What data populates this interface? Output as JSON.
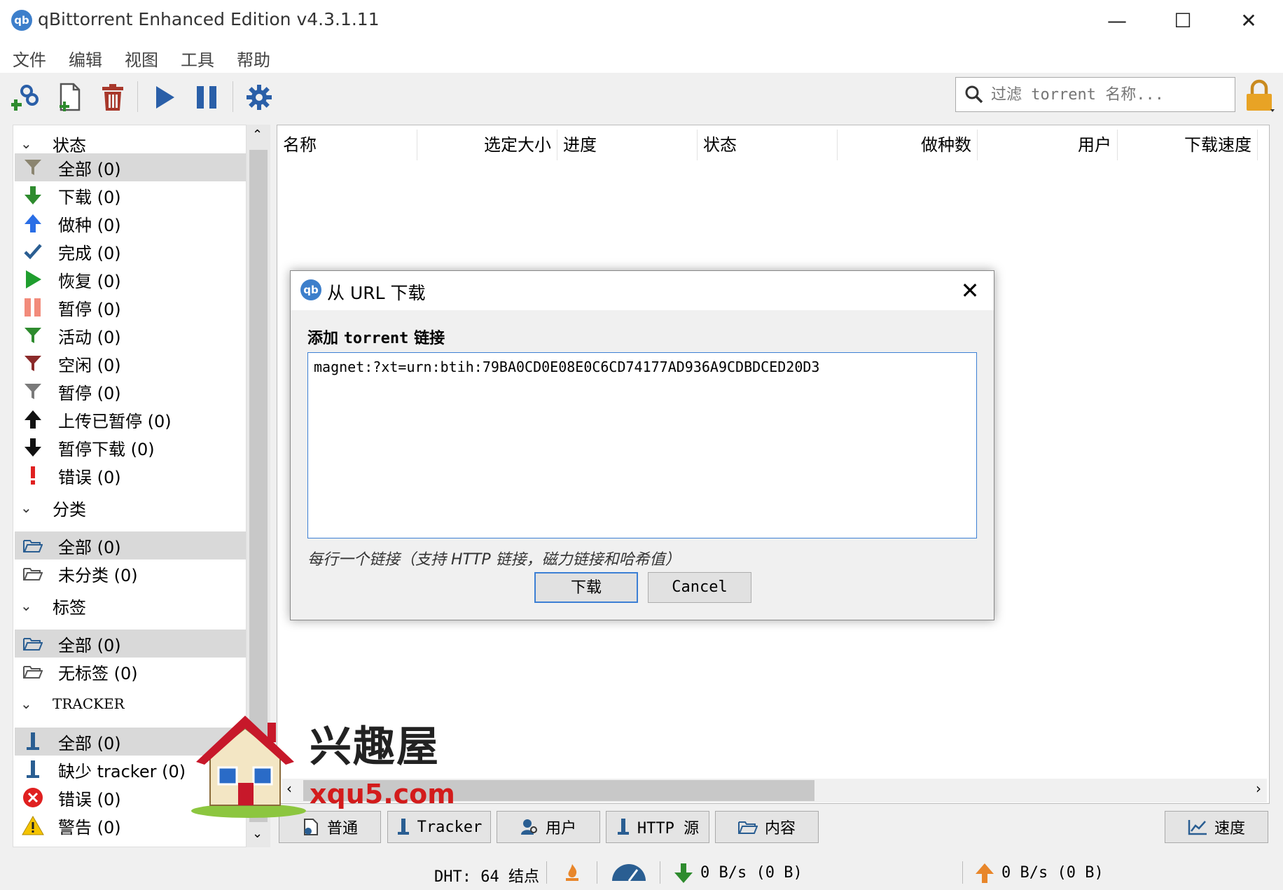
{
  "window": {
    "app_icon_text": "qb",
    "title": "qBittorrent Enhanced Edition v4.3.1.11",
    "minimize": "—",
    "maximize": "☐",
    "close": "✕"
  },
  "menu": [
    "文件",
    "编辑",
    "视图",
    "工具",
    "帮助"
  ],
  "search": {
    "placeholder": "过滤 torrent 名称..."
  },
  "sidebar": {
    "status_header": "状态",
    "status_items": [
      {
        "label": "全部 (0)",
        "icon": "filter-icon"
      },
      {
        "label": "下载 (0)",
        "icon": "arrow-down-icon"
      },
      {
        "label": "做种 (0)",
        "icon": "arrow-up-icon"
      },
      {
        "label": "完成 (0)",
        "icon": "check-icon"
      },
      {
        "label": "恢复 (0)",
        "icon": "play-icon"
      },
      {
        "label": "暂停 (0)",
        "icon": "pause-icon"
      },
      {
        "label": "活动 (0)",
        "icon": "filter-icon"
      },
      {
        "label": "空闲 (0)",
        "icon": "filter-icon"
      },
      {
        "label": "暂停 (0)",
        "icon": "filter-icon"
      },
      {
        "label": "上传已暂停 (0)",
        "icon": "arrow-up-icon"
      },
      {
        "label": "暂停下载 (0)",
        "icon": "arrow-down-icon"
      },
      {
        "label": "错误 (0)",
        "icon": "exclamation-icon"
      }
    ],
    "category_header": "分类",
    "category_items": [
      "全部 (0)",
      "未分类 (0)"
    ],
    "tag_header": "标签",
    "tag_items": [
      "全部 (0)",
      "无标签 (0)"
    ],
    "tracker_header": "TRACKER",
    "tracker_items": [
      "全部 (0)",
      "缺少 tracker (0)",
      "错误 (0)",
      "警告 (0)"
    ]
  },
  "table": {
    "columns": [
      "名称",
      "选定大小",
      "进度",
      "状态",
      "做种数",
      "用户",
      "下载速度"
    ]
  },
  "tabs": [
    "普通",
    "Tracker",
    "用户",
    "HTTP 源",
    "内容"
  ],
  "speed_tab": "速度",
  "status": {
    "dht": "DHT: 64 结点",
    "down": "0 B/s (0 B)",
    "up": "0 B/s (0 B)"
  },
  "dialog": {
    "icon_text": "qb",
    "title": "从 URL 下载",
    "label_prefix": "添加",
    "label_mono": "torrent",
    "label_suffix": "链接",
    "url_value": "magnet:?xt=urn:btih:79BA0CD0E08E0C6CD74177AD936A9CDBDCED20D3",
    "hint": "每行一个链接（支持 HTTP 链接，磁力链接和哈希值）",
    "download_btn": "下载",
    "cancel_btn": "Cancel"
  },
  "watermark": {
    "cn": "兴趣屋",
    "url": "xqu5.com"
  },
  "colors": {
    "accent": "#3c7fd4",
    "green": "#2e8b2e",
    "blue": "#2a6ee6",
    "red": "#d32f2f",
    "pause_red": "#f28b7b",
    "delete_red": "#a8382b"
  }
}
